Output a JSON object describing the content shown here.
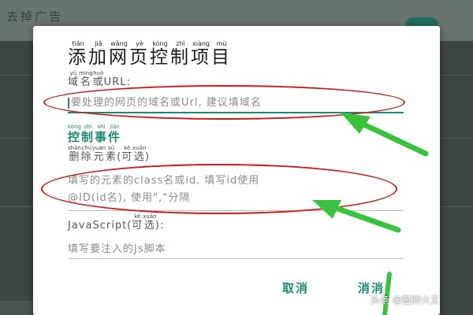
{
  "background": {
    "header_title": "去掉广告",
    "colors": {
      "scrim": "#3f4543",
      "toggle": "#1f6e5e"
    }
  },
  "dialog": {
    "title": [
      {
        "c": "添",
        "p": "tiān"
      },
      {
        "c": "加",
        "p": "jiā"
      },
      {
        "c": "网",
        "p": "wǎng"
      },
      {
        "c": "页",
        "p": "yè"
      },
      {
        "c": "控",
        "p": "kòng"
      },
      {
        "c": "制",
        "p": "zhì"
      },
      {
        "c": "项",
        "p": "xiàng"
      },
      {
        "c": "目",
        "p": "mù"
      }
    ],
    "domain_label": [
      {
        "c": "域",
        "p": "yù"
      },
      {
        "c": "名",
        "p": "míng"
      },
      {
        "c": "或",
        "p": "huò"
      },
      {
        "c": "URL:",
        "p": ""
      }
    ],
    "domain_placeholder": "要处理的网页的域名或Url, 建议填域名",
    "section_title": [
      {
        "c": "控",
        "p": "kòng"
      },
      {
        "c": "制",
        "p": "zhì"
      },
      {
        "c": "事",
        "p": "shì"
      },
      {
        "c": "件",
        "p": "jiàn"
      }
    ],
    "remove_label": [
      {
        "c": "删",
        "p": "shān"
      },
      {
        "c": "除",
        "p": "chú"
      },
      {
        "c": "元",
        "p": "yuán"
      },
      {
        "c": "素",
        "p": "sù"
      },
      {
        "c": "(",
        "p": ""
      },
      {
        "c": "可",
        "p": "kě"
      },
      {
        "c": "选",
        "p": "xuǎn"
      },
      {
        "c": ")",
        "p": ""
      }
    ],
    "remove_placeholder_line1": "填写的元素的class名或id, 填写id使用",
    "remove_placeholder_line2": "@ID(id名), 使用\",\"分隔",
    "js_label": [
      {
        "c": "JavaScript(",
        "p": ""
      },
      {
        "c": "可",
        "p": "kě"
      },
      {
        "c": "选",
        "p": "xuǎn"
      },
      {
        "c": "):",
        "p": ""
      }
    ],
    "js_placeholder": "填写要注入的Js脚本",
    "cancel_button": "取消",
    "confirm_button": "消消",
    "colors": {
      "accent": "#1d8b74",
      "annotation": "#cc1a1a",
      "arrow": "#39c23c"
    }
  },
  "watermark": "头条 @鳖脚大王"
}
